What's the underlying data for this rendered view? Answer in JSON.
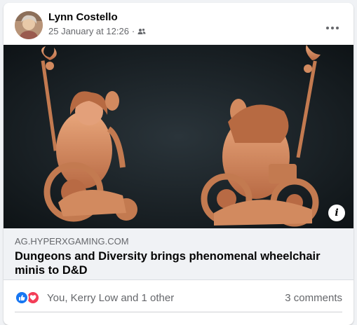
{
  "post": {
    "author": "Lynn Costello",
    "timestamp": "25 January at 12:26",
    "separator": "·",
    "audience_icon": "friends-icon",
    "more_icon": "more-options-icon"
  },
  "link": {
    "domain": "AG.HYPERXGAMING.COM",
    "title": "Dungeons and Diversity brings phenomenal wheelchair minis to D&D",
    "info_label": "i"
  },
  "reactions": {
    "icons": [
      "like-icon",
      "love-icon"
    ],
    "summary": "You, Kerry Low and 1 other",
    "comments": "3 comments"
  },
  "colors": {
    "like": "#1877f2",
    "love": "#f33e58",
    "secondary_text": "#65676b",
    "link_bg": "#f0f2f5",
    "miniature": "#d8926a"
  }
}
